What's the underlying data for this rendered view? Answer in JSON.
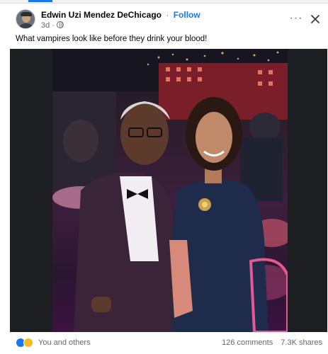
{
  "post": {
    "author": "Edwin Uzi Mendez DeChicago",
    "follow_label": "Follow",
    "separator": "·",
    "time": "3d ·",
    "text": "What vampires look like before they drink your blood!"
  },
  "header": {
    "more_icon": "more-horizontal-icon",
    "close_icon": "close-icon",
    "privacy_icon": "globe-icon"
  },
  "footer": {
    "reactions_label": "You and others",
    "comments": "126 comments",
    "shares": "7.3K shares",
    "reaction_icons": [
      "like-icon",
      "care-icon"
    ]
  },
  "colors": {
    "accent": "#1877f2",
    "secondary_text": "#65676b",
    "photo_background": "#1c1e21"
  }
}
